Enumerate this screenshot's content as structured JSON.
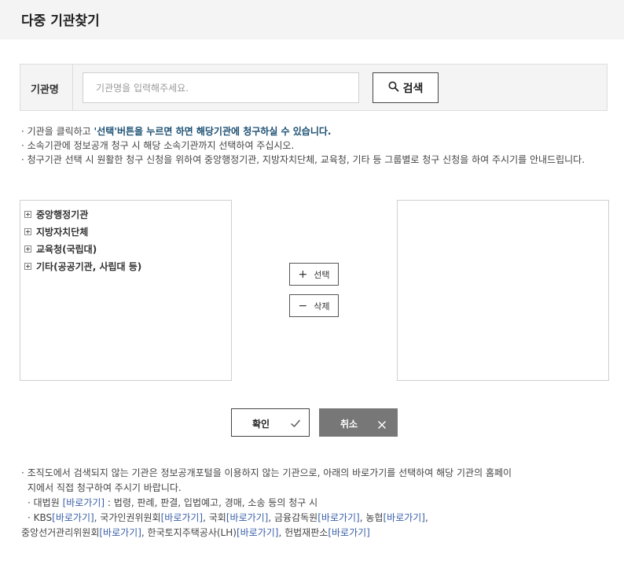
{
  "header": {
    "title": "다중 기관찾기"
  },
  "search": {
    "label": "기관명",
    "placeholder": "기관명을 입력해주세요.",
    "value": "",
    "button_label": "검색",
    "button_icon": "search-icon"
  },
  "notes": {
    "line1_prefix": "· 기관을 클릭하고 ",
    "line1_highlight": "'선택'버튼을 누르면 하면 해당기관에 청구하실 수 있습니다.",
    "line2": "· 소속기관에 정보공개 청구 시 해당 소속기관까지 선택하여 주십시오.",
    "line3": "· 청구기관 선택 시 원활한 청구 신청을 위하여 중앙행정기관, 지방자치단체, 교육청, 기타 등 그룹별로 청구 신청을 하여 주시기를 안내드립니다."
  },
  "tree": {
    "expand_icon": "expand-plus-icon",
    "items": [
      "중앙행정기관",
      "지방자치단체",
      "교육청(국립대)",
      "기타(공공기관, 사립대 등)"
    ]
  },
  "actions": {
    "select_symbol": "+",
    "select_label": "선택",
    "delete_symbol": "−",
    "delete_label": "삭제"
  },
  "footer_buttons": {
    "confirm_label": "확인",
    "confirm_icon": "check-icon",
    "cancel_label": "취소",
    "cancel_icon": "close-icon"
  },
  "bottom_notes": {
    "line1a": "· 조직도에서 검색되지 않는 기관은 정보공개포털을 이용하지 않는 기관으로, 아래의 바로가기를 선택하여 해당 기관의 홈페이",
    "line1b": "지에서 직접 청구하여 주시기 바랍니다.",
    "court_prefix": "· 대법원 ",
    "court_suffix": " : 법령, 판례, 판결, 입법예고, 경매, 소송 등의 청구 시",
    "shortcut": "[바로가기]",
    "kbs": "· KBS",
    "nhrc": ", 국가인권위원회",
    "assembly": ", 국회",
    "fss": ", 금융감독원",
    "nh": ", 농협",
    "nec": "중앙선거관리위원회",
    "lh": ", 한국토지주택공사(LH)",
    "ccourt": ", 헌법재판소",
    "comma": ","
  },
  "colors": {
    "header_bg": "#f4f4f4",
    "highlight": "#1b4f72",
    "link": "#3a5fa8",
    "cancel_bg": "#777777"
  }
}
